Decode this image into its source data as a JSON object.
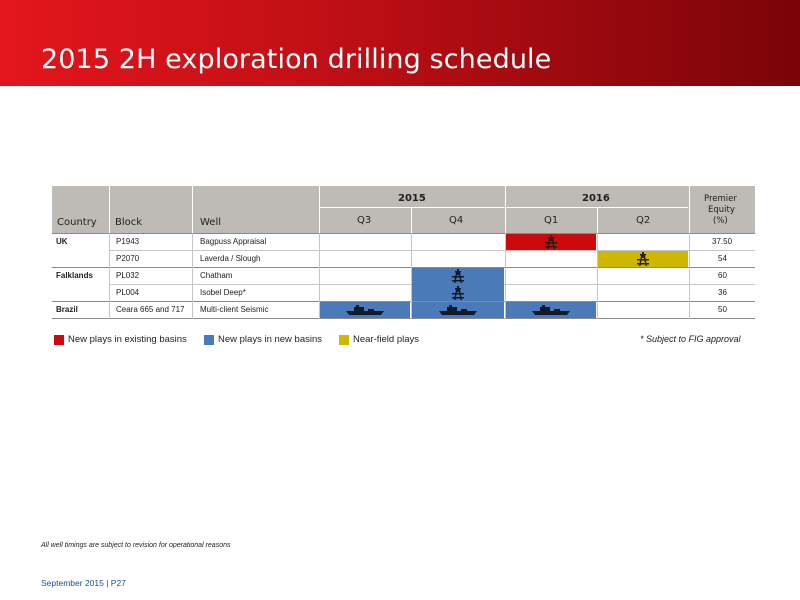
{
  "title": "2015 2H exploration drilling schedule",
  "table": {
    "headers": {
      "country": "Country",
      "block": "Block",
      "well": "Well",
      "year_2015": "2015",
      "year_2016": "2016",
      "q3": "Q3",
      "q4": "Q4",
      "q1": "Q1",
      "q2": "Q2",
      "equity_line1": "Premier",
      "equity_line2": "Equity",
      "equity_line3": "(%)"
    },
    "rows": [
      {
        "country": "UK",
        "block": "P1943",
        "well": "Bagpuss Appraisal",
        "equity": "37.50"
      },
      {
        "country": "",
        "block": "P2070",
        "well": "Laverda / Slough",
        "equity": "54"
      },
      {
        "country": "Falklands",
        "block": "PL032",
        "well": "Chatham",
        "equity": "60"
      },
      {
        "country": "",
        "block": "PL004",
        "well": "Isobel Deep*",
        "equity": "36"
      },
      {
        "country": "Brazil",
        "block": "Ceara 665 and 717",
        "well": "Multi-client Seismic",
        "equity": "50"
      }
    ]
  },
  "legend": {
    "red": "New plays in existing basins",
    "blue": "New plays in new basins",
    "yellow": "Near-field plays",
    "note": "* Subject to FIG approval"
  },
  "colors": {
    "red": "#cc0a0d",
    "blue": "#4a7ab8",
    "yellow": "#cfb700",
    "header_bg": "#bebab5"
  },
  "icons": {
    "rig": "drilling-rig-icon",
    "ship": "seismic-ship-icon"
  },
  "footnote": "All well timings are subject to revision for operational reasons",
  "page_label": "September 2015 | P27"
}
